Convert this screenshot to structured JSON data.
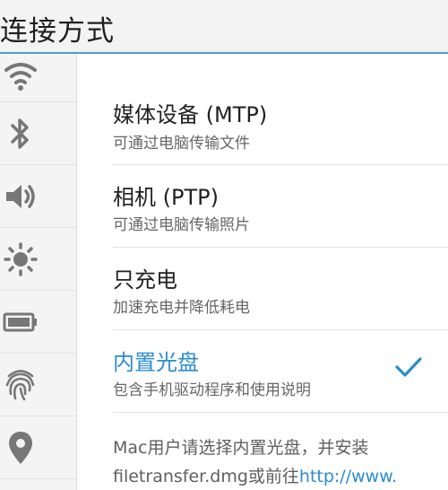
{
  "header": {
    "title": "连接方式",
    "accent_color": "#4a9fd3"
  },
  "sidebar": {
    "items": [
      {
        "icon": "wifi-icon"
      },
      {
        "icon": "bluetooth-icon"
      },
      {
        "icon": "volume-icon"
      },
      {
        "icon": "brightness-icon"
      },
      {
        "icon": "battery-icon"
      },
      {
        "icon": "fingerprint-icon"
      },
      {
        "icon": "location-icon"
      }
    ]
  },
  "options": [
    {
      "title": "媒体设备 (MTP)",
      "subtitle": "可通过电脑传输文件",
      "selected": false
    },
    {
      "title": "相机 (PTP)",
      "subtitle": "可通过电脑传输照片",
      "selected": false
    },
    {
      "title": "只充电",
      "subtitle": "加速充电并降低耗电",
      "selected": false
    },
    {
      "title": "内置光盘",
      "subtitle": "包含手机驱动程序和使用说明",
      "selected": true
    }
  ],
  "info": {
    "line1": "Mac用户请选择内置光盘，并安装",
    "line2_text": "filetransfer.dmg或前往",
    "line2_link": "http://www."
  },
  "colors": {
    "selected": "#2b8ccf",
    "icon": "#777777"
  }
}
